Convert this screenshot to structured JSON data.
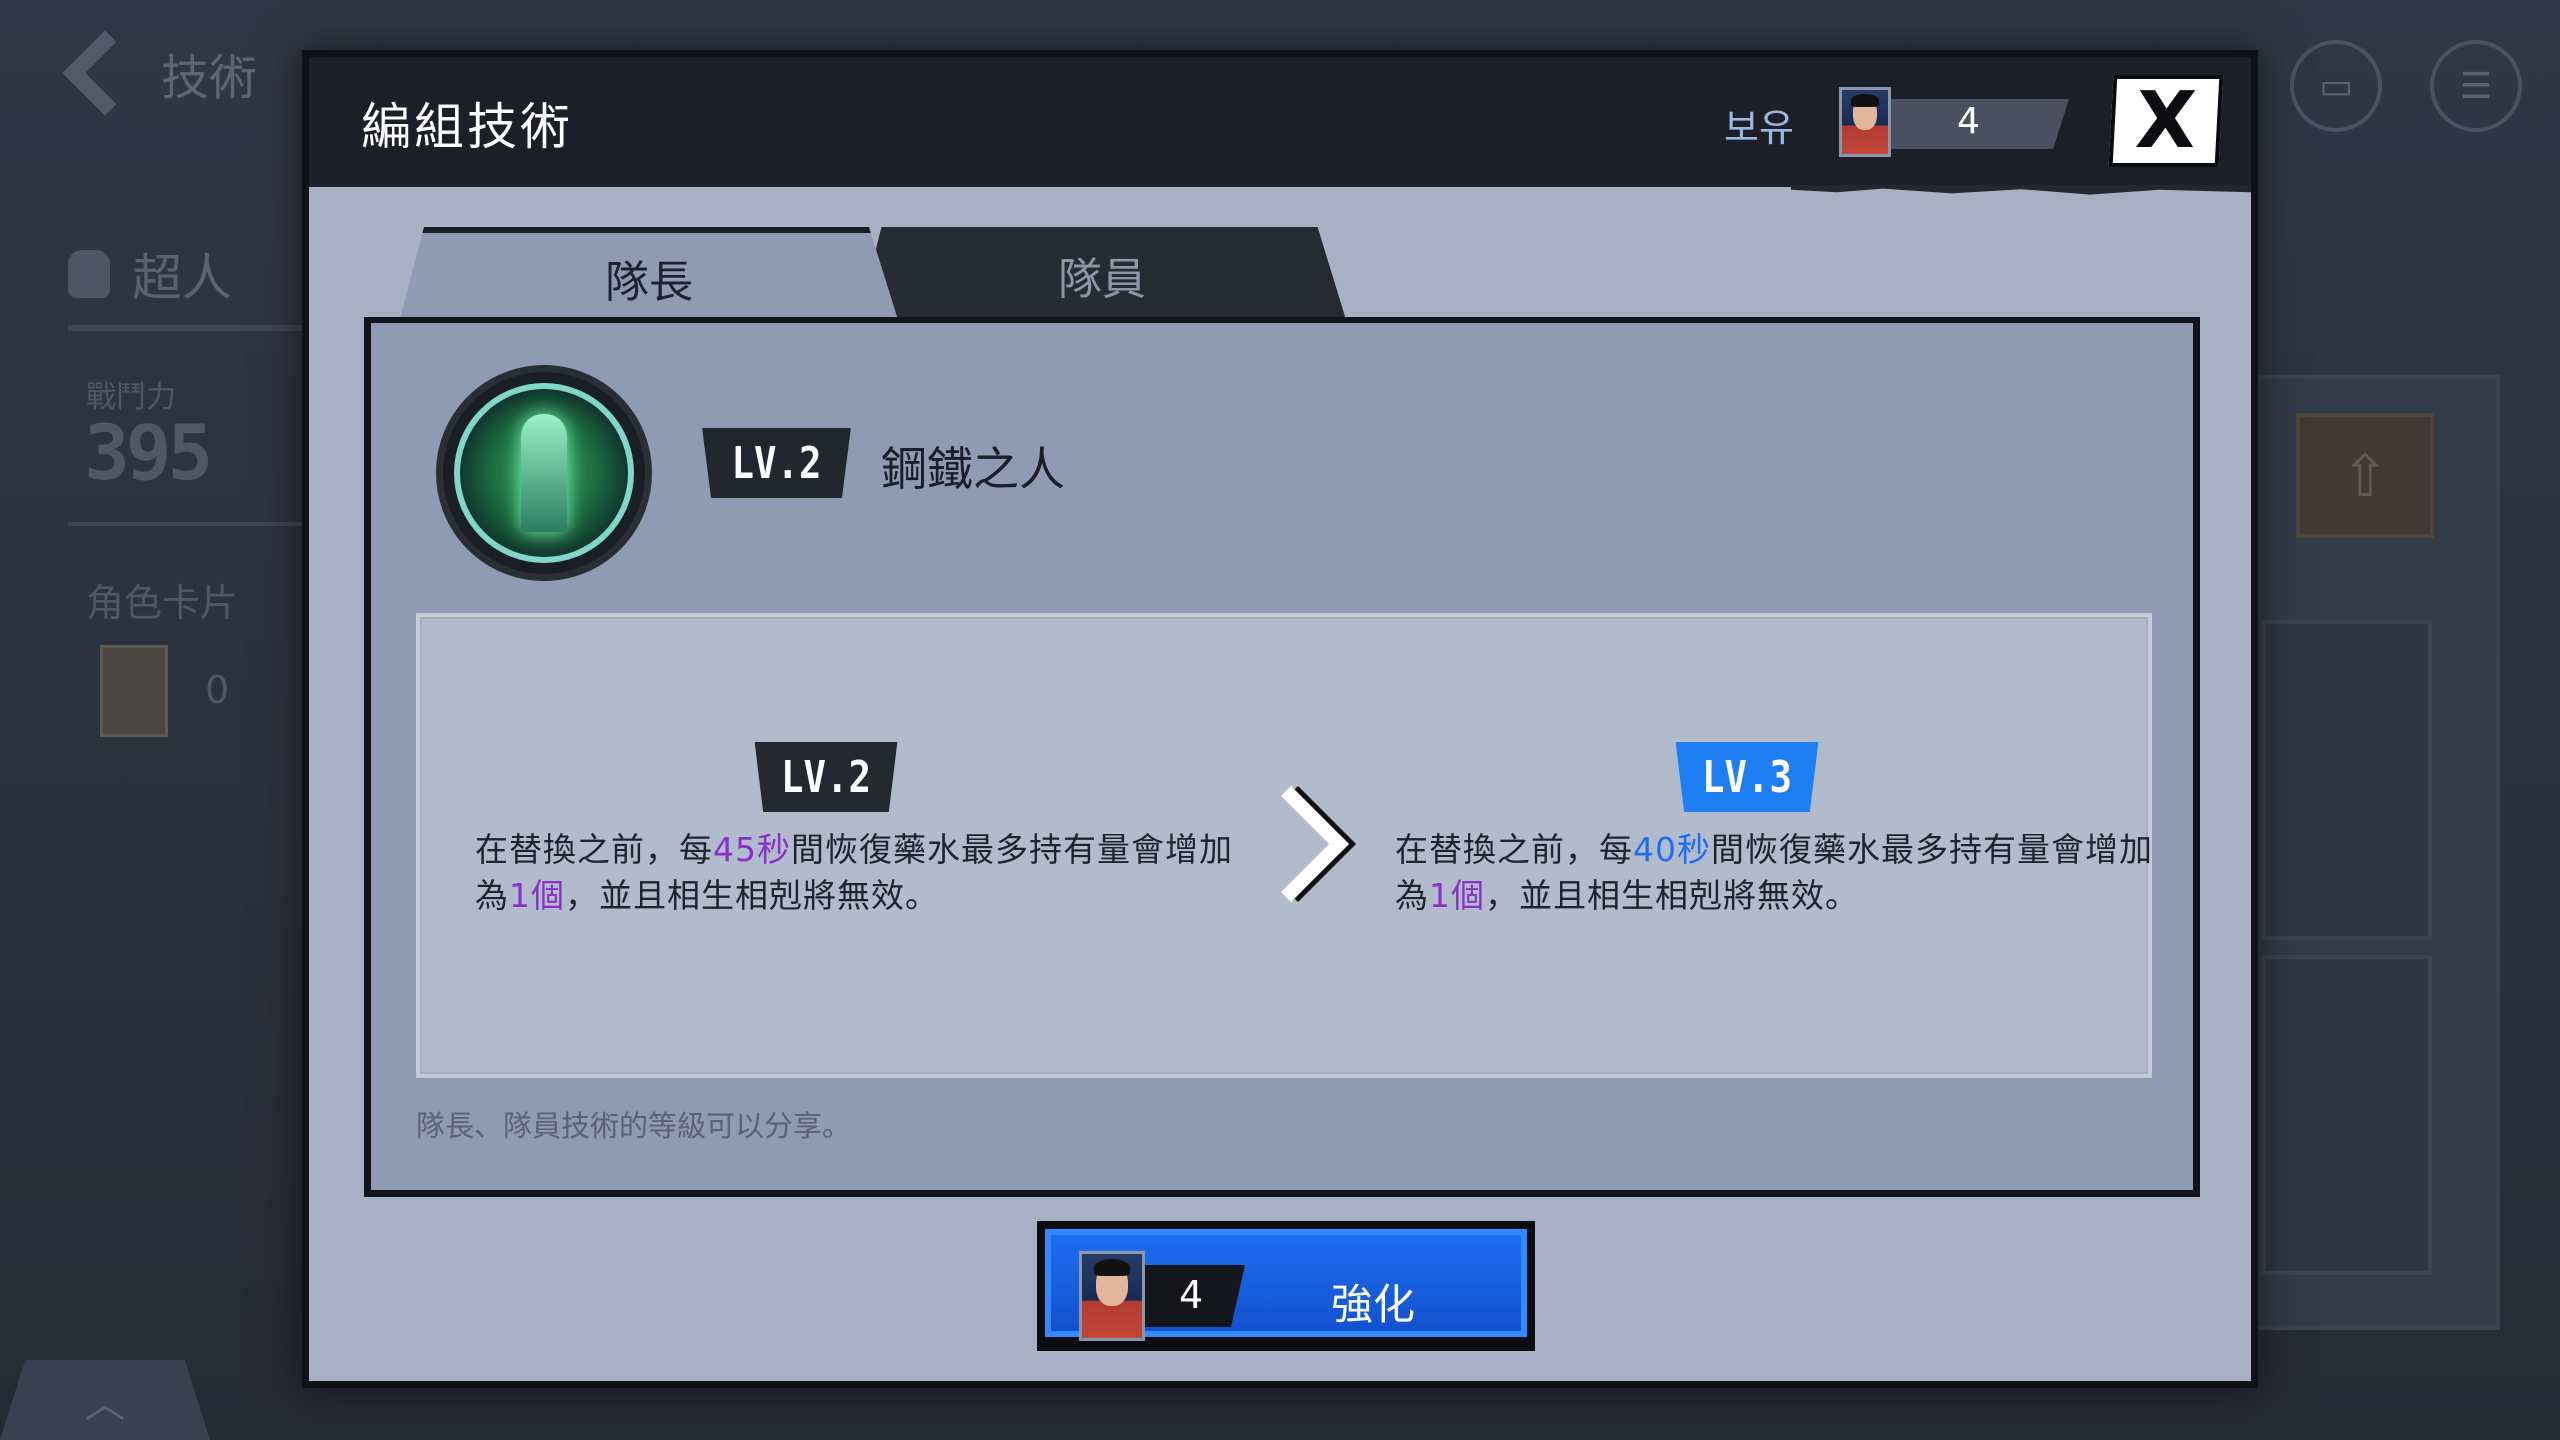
{
  "background": {
    "back_label": "技術",
    "character_name": "超人",
    "power_label": "戰鬥力",
    "power_value": "395",
    "cards_label": "角色卡片",
    "card_count": "0",
    "chat_icon": "chat-bubble-icon",
    "menu_icon": "list-menu-icon",
    "upload_icon": "upload-arrow-icon",
    "expand_icon": "chevron-up-icon"
  },
  "modal": {
    "title": "編組技術",
    "owned_label": "보유",
    "owned_count": "4",
    "close_label": "X",
    "tabs": [
      {
        "label": "隊長",
        "active": true
      },
      {
        "label": "隊員",
        "active": false
      }
    ],
    "skill": {
      "level": "LV.2",
      "name": "鋼鐵之人",
      "icon": "superman-emblem-icon"
    },
    "current": {
      "level": "LV.2",
      "text_before": "在替換之前，每",
      "seconds": "45秒",
      "text_mid": "間恢復藥水最多持有量會增加為",
      "amount": "1個",
      "text_after": "，並且相生相剋將無效。"
    },
    "next": {
      "level": "LV.3",
      "text_before": "在替換之前，每",
      "seconds": "40秒",
      "text_mid": "間恢復藥水最多持有量會增加為",
      "amount": "1個",
      "text_after": "，並且相生相剋將無效。"
    },
    "note": "隊長、隊員技術的等級可以分享。",
    "upgrade": {
      "cost": "4",
      "label": "強化"
    }
  },
  "colors": {
    "accent_blue": "#1e7ff3",
    "highlight_purple": "#8b2fc9",
    "highlight_blue": "#1d6ff0",
    "header_dark": "#1c1f27",
    "panel": "#8f9bb3"
  }
}
